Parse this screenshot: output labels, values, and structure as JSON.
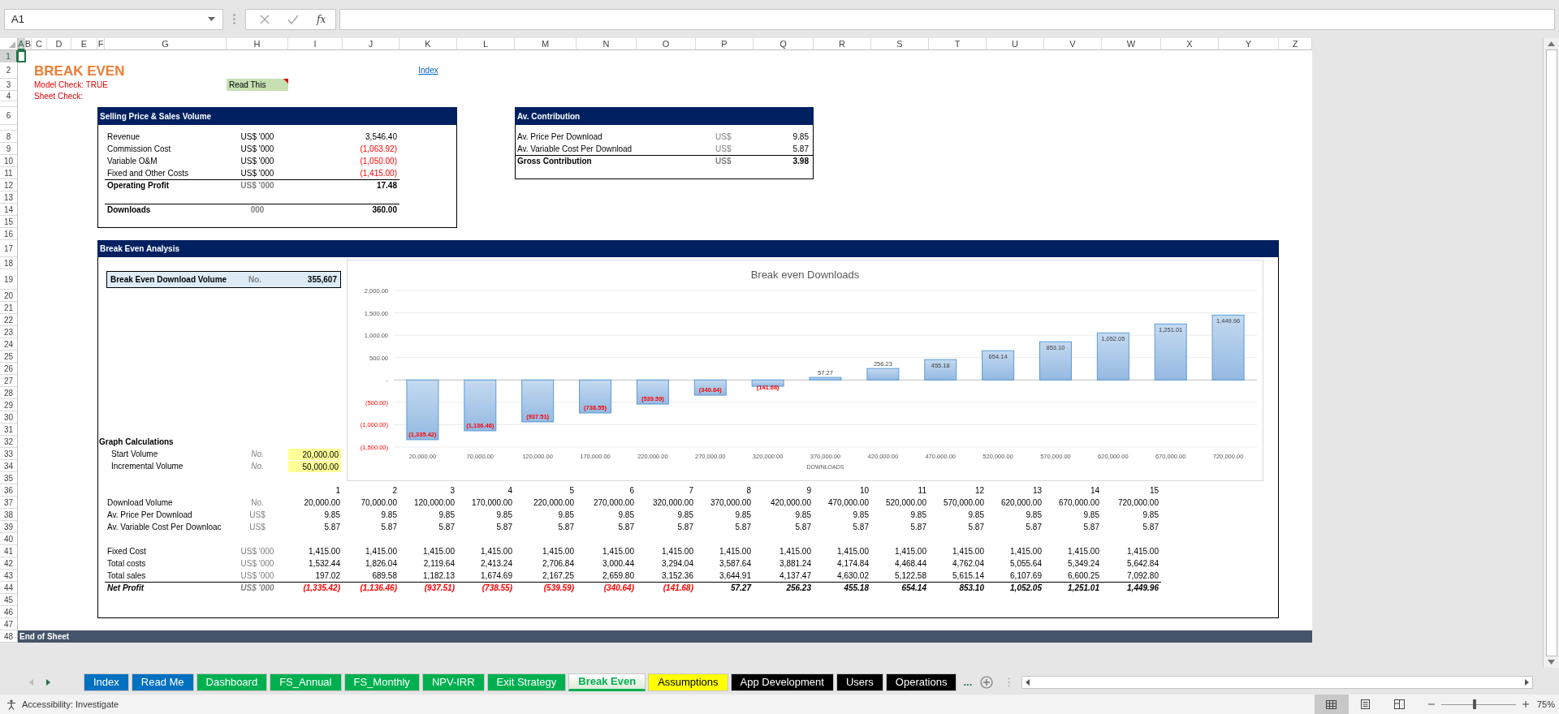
{
  "name_box": "A1",
  "function_label": "fx",
  "column_headers": [
    {
      "label": "A",
      "selected": true
    },
    {
      "label": "B",
      "selected": false
    },
    {
      "label": "C",
      "selected": false
    },
    {
      "label": "D",
      "selected": false
    },
    {
      "label": "E",
      "selected": false
    },
    {
      "label": "F",
      "selected": false
    },
    {
      "label": "G",
      "selected": false
    },
    {
      "label": "H",
      "selected": false
    },
    {
      "label": "I",
      "selected": false
    },
    {
      "label": "J",
      "selected": false
    },
    {
      "label": "K",
      "selected": false
    },
    {
      "label": "L",
      "selected": false
    },
    {
      "label": "M",
      "selected": false
    },
    {
      "label": "N",
      "selected": false
    },
    {
      "label": "O",
      "selected": false
    },
    {
      "label": "P",
      "selected": false
    },
    {
      "label": "Q",
      "selected": false
    },
    {
      "label": "R",
      "selected": false
    },
    {
      "label": "S",
      "selected": false
    },
    {
      "label": "T",
      "selected": false
    },
    {
      "label": "U",
      "selected": false
    },
    {
      "label": "V",
      "selected": false
    },
    {
      "label": "W",
      "selected": false
    },
    {
      "label": "X",
      "selected": false
    },
    {
      "label": "Y",
      "selected": false
    },
    {
      "label": "Z",
      "selected": false
    }
  ],
  "row_headers": [
    {
      "label": "1",
      "selected": true
    },
    {
      "label": "2",
      "selected": false
    },
    {
      "label": "3",
      "selected": false
    },
    {
      "label": "4",
      "selected": false
    },
    {
      "label": "6",
      "selected": false
    },
    {
      "label": "8",
      "selected": false
    },
    {
      "label": "9",
      "selected": false
    },
    {
      "label": "10",
      "selected": false
    },
    {
      "label": "11",
      "selected": false
    },
    {
      "label": "12",
      "selected": false
    },
    {
      "label": "13",
      "selected": false
    },
    {
      "label": "14",
      "selected": false
    },
    {
      "label": "15",
      "selected": false
    },
    {
      "label": "16",
      "selected": false
    },
    {
      "label": "17",
      "selected": false
    },
    {
      "label": "18",
      "selected": false
    },
    {
      "label": "19",
      "selected": false
    },
    {
      "label": "20",
      "selected": false
    },
    {
      "label": "21",
      "selected": false
    },
    {
      "label": "22",
      "selected": false
    },
    {
      "label": "23",
      "selected": false
    },
    {
      "label": "24",
      "selected": false
    },
    {
      "label": "25",
      "selected": false
    },
    {
      "label": "26",
      "selected": false
    },
    {
      "label": "27",
      "selected": false
    },
    {
      "label": "28",
      "selected": false
    },
    {
      "label": "29",
      "selected": false
    },
    {
      "label": "30",
      "selected": false
    },
    {
      "label": "31",
      "selected": false
    },
    {
      "label": "32",
      "selected": false
    },
    {
      "label": "33",
      "selected": false
    },
    {
      "label": "34",
      "selected": false
    },
    {
      "label": "35",
      "selected": false
    },
    {
      "label": "36",
      "selected": false
    },
    {
      "label": "37",
      "selected": false
    },
    {
      "label": "38",
      "selected": false
    },
    {
      "label": "39",
      "selected": false
    },
    {
      "label": "40",
      "selected": false
    },
    {
      "label": "41",
      "selected": false
    },
    {
      "label": "42",
      "selected": false
    },
    {
      "label": "43",
      "selected": false
    },
    {
      "label": "44",
      "selected": false
    },
    {
      "label": "45",
      "selected": false
    },
    {
      "label": "46",
      "selected": false
    },
    {
      "label": "47",
      "selected": false
    },
    {
      "label": "48",
      "selected": false
    }
  ],
  "title": "BREAK EVEN",
  "model_check": "Model Check: TRUE",
  "sheet_check": "Sheet Check:",
  "read_this": {
    "label": "Read This",
    "has_comment": true
  },
  "index_link": "Index",
  "sales_box": {
    "title": "Selling Price & Sales Volume",
    "rows": [
      {
        "label": "Revenue",
        "unit": "US$ '000",
        "value": "3,546.40",
        "negative": false,
        "kind": "item"
      },
      {
        "label": "Commission Cost",
        "unit": "US$ '000",
        "value": "(1,063.92)",
        "negative": true,
        "kind": "item"
      },
      {
        "label": "Variable O&M",
        "unit": "US$ '000",
        "value": "(1,050.00)",
        "negative": true,
        "kind": "item"
      },
      {
        "label": "Fixed and Other Costs",
        "unit": "US$ '000",
        "value": "(1,415.00)",
        "negative": true,
        "kind": "item"
      },
      {
        "label": "Operating Profit",
        "unit": "US$ '000",
        "value": "17.48",
        "negative": false,
        "kind": "total"
      },
      {
        "label": "Downloads",
        "unit": "000",
        "value": "360.00",
        "negative": false,
        "kind": "total"
      }
    ]
  },
  "contribution_box": {
    "title": "Av. Contribution",
    "rows": [
      {
        "label": "Av. Price Per Download",
        "unit": "US$",
        "value": "9.85",
        "kind": "item"
      },
      {
        "label": "Av. Variable Cost Per Download",
        "unit": "US$",
        "value": "5.87",
        "kind": "item"
      },
      {
        "label": "Gross Contribution",
        "unit": "US$",
        "value": "3.98",
        "kind": "total"
      }
    ]
  },
  "analysis": {
    "title": "Break Even Analysis",
    "break_even": {
      "label": "Break Even Download Volume",
      "unit": "No.",
      "value": "355,607"
    },
    "graph_calculations": {
      "title": "Graph Calculations",
      "inputs": [
        {
          "label": "Start Volume",
          "unit": "No.",
          "value": "20,000.00"
        },
        {
          "label": "Incremental Volume",
          "unit": "No.",
          "value": "50,000.00"
        }
      ]
    },
    "chart_data": {
      "type": "bar",
      "title": "Break even Downloads",
      "xlabel": "DOWNLOADS",
      "grid": true,
      "categories": [
        "20,000.00",
        "70,000.00",
        "120,000.00",
        "170,000.00",
        "220,000.00",
        "270,000.00",
        "320,000.00",
        "370,000.00",
        "420,000.00",
        "470,000.00",
        "520,000.00",
        "570,000.00",
        "620,000.00",
        "670,000.00",
        "720,000.00"
      ],
      "values": [
        -1335.42,
        -1136.46,
        -937.51,
        -738.55,
        -539.59,
        -340.64,
        -141.68,
        57.27,
        256.23,
        455.18,
        654.14,
        853.1,
        1052.05,
        1251.01,
        1449.96
      ],
      "value_labels": [
        "(1,335.42)",
        "(1,136.46)",
        "(937.51)",
        "(738.55)",
        "(539.59)",
        "(340.64)",
        "(141.68)",
        "57.27",
        "256.23",
        "455.18",
        "654.14",
        "853.10",
        "1,052.05",
        "1,251.01",
        "1,449.96"
      ],
      "ylim": [
        -1500,
        2000
      ],
      "yticks": [
        {
          "value": 2000,
          "label": "2,000.00"
        },
        {
          "value": 1500,
          "label": "1,500.00"
        },
        {
          "value": 1000,
          "label": "1,000.00"
        },
        {
          "value": 500,
          "label": "500.00"
        },
        {
          "value": 0,
          "label": "-"
        },
        {
          "value": -500,
          "label": "(500.00)"
        },
        {
          "value": -1000,
          "label": "(1,000.00)"
        },
        {
          "value": -1500,
          "label": "(1,500.00)"
        }
      ]
    },
    "table": {
      "periods": [
        "1",
        "2",
        "3",
        "4",
        "5",
        "6",
        "7",
        "8",
        "9",
        "10",
        "11",
        "12",
        "13",
        "14",
        "15"
      ],
      "rows": [
        {
          "label": "Download Volume",
          "unit": "No.",
          "kind": "item",
          "values": [
            "20,000.00",
            "70,000.00",
            "120,000.00",
            "170,000.00",
            "220,000.00",
            "270,000.00",
            "320,000.00",
            "370,000.00",
            "420,000.00",
            "470,000.00",
            "520,000.00",
            "570,000.00",
            "620,000.00",
            "670,000.00",
            "720,000.00"
          ]
        },
        {
          "label": "Av. Price Per Download",
          "unit": "US$",
          "kind": "item",
          "values": [
            "9.85",
            "9.85",
            "9.85",
            "9.85",
            "9.85",
            "9.85",
            "9.85",
            "9.85",
            "9.85",
            "9.85",
            "9.85",
            "9.85",
            "9.85",
            "9.85",
            "9.85"
          ]
        },
        {
          "label": "Av. Variable Cost Per Downloac",
          "unit": "US$",
          "kind": "item",
          "values": [
            "5.87",
            "5.87",
            "5.87",
            "5.87",
            "5.87",
            "5.87",
            "5.87",
            "5.87",
            "5.87",
            "5.87",
            "5.87",
            "5.87",
            "5.87",
            "5.87",
            "5.87"
          ]
        },
        {
          "label": "Fixed Cost",
          "unit": "US$ '000",
          "kind": "item",
          "values": [
            "1,415.00",
            "1,415.00",
            "1,415.00",
            "1,415.00",
            "1,415.00",
            "1,415.00",
            "1,415.00",
            "1,415.00",
            "1,415.00",
            "1,415.00",
            "1,415.00",
            "1,415.00",
            "1,415.00",
            "1,415.00",
            "1,415.00"
          ]
        },
        {
          "label": "Total costs",
          "unit": "US$ '000",
          "kind": "item",
          "values": [
            "1,532.44",
            "1,826.04",
            "2,119.64",
            "2,413.24",
            "2,706.84",
            "3,000.44",
            "3,294.04",
            "3,587.64",
            "3,881.24",
            "4,174.84",
            "4,468.44",
            "4,762.04",
            "5,055.64",
            "5,349.24",
            "5,642.84"
          ]
        },
        {
          "label": "Total sales",
          "unit": "US$ '000",
          "kind": "item",
          "values": [
            "197.02",
            "689.58",
            "1,182.13",
            "1,674.69",
            "2,167.25",
            "2,659.80",
            "3,152.36",
            "3,644.91",
            "4,137.47",
            "4,630.02",
            "5,122.58",
            "5,615.14",
            "6,107.69",
            "6,600.25",
            "7,092.80"
          ]
        },
        {
          "label": "Net Profit",
          "unit": "US$ '000",
          "kind": "total",
          "values": [
            {
              "text": "(1,335.42)",
              "negative": true
            },
            {
              "text": "(1,136.46)",
              "negative": true
            },
            {
              "text": "(937.51)",
              "negative": true
            },
            {
              "text": "(738.55)",
              "negative": true
            },
            {
              "text": "(539.59)",
              "negative": true
            },
            {
              "text": "(340.64)",
              "negative": true
            },
            {
              "text": "(141.68)",
              "negative": true
            },
            {
              "text": "57.27",
              "negative": false
            },
            {
              "text": "256.23",
              "negative": false
            },
            {
              "text": "455.18",
              "negative": false
            },
            {
              "text": "654.14",
              "negative": false
            },
            {
              "text": "853.10",
              "negative": false
            },
            {
              "text": "1,052.05",
              "negative": false
            },
            {
              "text": "1,251.01",
              "negative": false
            },
            {
              "text": "1,449.96",
              "negative": false
            }
          ]
        }
      ]
    }
  },
  "end_of_sheet": "End of Sheet",
  "sheet_tabs": [
    {
      "label": "Index",
      "color": "#0070c0",
      "selected": false
    },
    {
      "label": "Read Me",
      "color": "#0070c0",
      "selected": false
    },
    {
      "label": "Dashboard",
      "color": "#00b050",
      "selected": false
    },
    {
      "label": "FS_Annual",
      "color": "#00b050",
      "selected": false
    },
    {
      "label": "FS_Monthly",
      "color": "#00b050",
      "selected": false
    },
    {
      "label": "NPV-IRR",
      "color": "#00b050",
      "selected": false
    },
    {
      "label": "Exit Strategy",
      "color": "#00b050",
      "selected": false
    },
    {
      "label": "Break Even",
      "color": "#00b050",
      "selected": true
    },
    {
      "label": "Assumptions",
      "color": "#ffff00",
      "selected": false
    },
    {
      "label": "App Development",
      "color": "#000000",
      "selected": false
    },
    {
      "label": "Users",
      "color": "#000000",
      "selected": false
    },
    {
      "label": "Operations",
      "color": "#000000",
      "selected": false
    }
  ],
  "tab_overflow": "...",
  "status_text": "Accessibility: Investigate",
  "zoom_slider": {
    "level": 0.45
  },
  "zoom_percent": "75%"
}
